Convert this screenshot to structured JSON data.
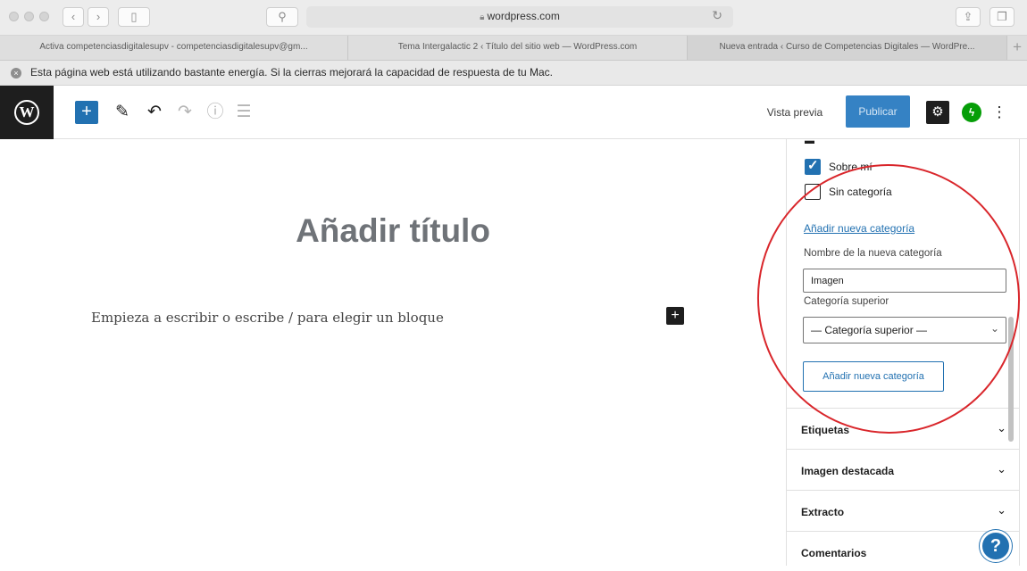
{
  "browser": {
    "url": "wordpress.com",
    "back_icon": "chevron-left-icon",
    "forward_icon": "chevron-right-icon",
    "tabs": [
      {
        "label": "Activa competenciasdigitalesupv - competenciasdigitalesupv@gm..."
      },
      {
        "label": "Tema Intergalactic 2 ‹ Título del sitio web — WordPress.com"
      },
      {
        "label": "Nueva entrada ‹ Curso de Competencias Digitales — WordPre..."
      }
    ],
    "energy_warning": "Esta página web está utilizando bastante energía. Si la cierras mejorará la capacidad de respuesta de tu Mac."
  },
  "editor_header": {
    "preview_label": "Vista previa",
    "publish_label": "Publicar",
    "icons": [
      "wordpress-logo-icon",
      "plus-icon",
      "pencil-icon",
      "undo-icon",
      "redo-icon",
      "info-icon",
      "list-view-icon",
      "gear-icon",
      "jetpack-icon",
      "more-vertical-icon"
    ],
    "accent_color": "#3582c4"
  },
  "editor": {
    "title_placeholder": "Añadir título",
    "paragraph_placeholder": "Empieza a escribir o escribe / para elegir un bloque"
  },
  "sidebar": {
    "categories": [
      {
        "label": "Sobre mí",
        "checked": true
      },
      {
        "label": "Sin categoría",
        "checked": false
      }
    ],
    "add_new_category_link": "Añadir nueva categoría",
    "new_category_name_label": "Nombre de la nueva categoría",
    "new_category_name_value": "Imagen",
    "parent_category_label": "Categoría superior",
    "parent_category_selected": "— Categoría superior —",
    "add_new_category_button": "Añadir nueva categoría",
    "panels": [
      {
        "title": "Etiquetas"
      },
      {
        "title": "Imagen destacada"
      },
      {
        "title": "Extracto"
      },
      {
        "title": "Comentarios"
      }
    ]
  },
  "annotation_color": "#d9262b"
}
